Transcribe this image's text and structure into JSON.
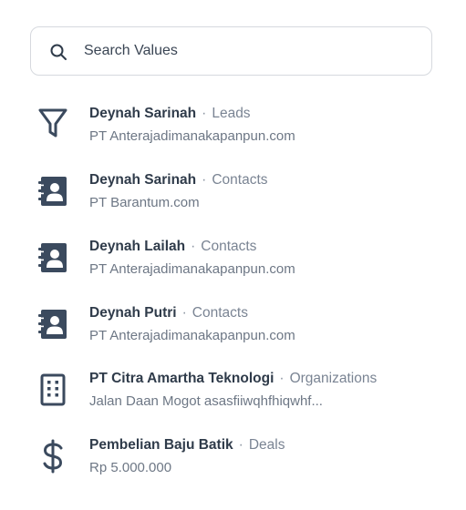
{
  "search": {
    "placeholder": "Search Values",
    "icon": "search-icon"
  },
  "colors": {
    "icon": "#3b4a5e",
    "title": "#2f3b4a",
    "secondary": "#6d7785",
    "border": "#d6d9de"
  },
  "results": [
    {
      "icon": "funnel-icon",
      "title": "Deynah Sarinah",
      "separator": "·",
      "category": "Leads",
      "subtitle": "PT Anterajadimanakapanpun.com"
    },
    {
      "icon": "contact-book-icon",
      "title": "Deynah Sarinah",
      "separator": "·",
      "category": "Contacts",
      "subtitle": "PT Barantum.com"
    },
    {
      "icon": "contact-book-icon",
      "title": "Deynah Lailah",
      "separator": "·",
      "category": "Contacts",
      "subtitle": "PT Anterajadimanakapanpun.com"
    },
    {
      "icon": "contact-book-icon",
      "title": "Deynah Putri",
      "separator": "·",
      "category": "Contacts",
      "subtitle": "PT Anterajadimanakapanpun.com"
    },
    {
      "icon": "building-icon",
      "title": "PT Citra Amartha Teknologi",
      "separator": "·",
      "category": "Organizations",
      "subtitle": "Jalan Daan Mogot asasfiiwqhfhiqwhf..."
    },
    {
      "icon": "dollar-icon",
      "title": "Pembelian Baju Batik",
      "separator": "·",
      "category": "Deals",
      "subtitle": "Rp 5.000.000"
    }
  ]
}
